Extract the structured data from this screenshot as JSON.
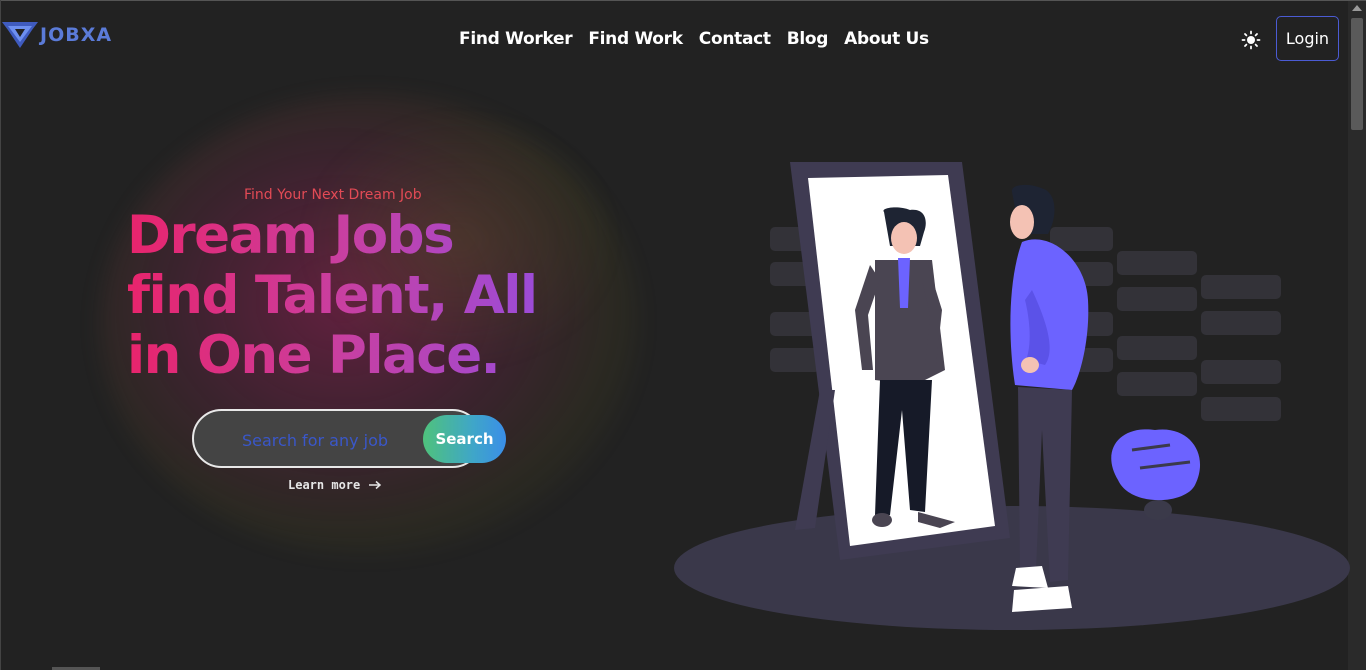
{
  "app": {
    "brand": "JOBXA",
    "brand_color": "#5b7bd8"
  },
  "nav": {
    "items": [
      {
        "label": "Find Worker"
      },
      {
        "label": "Find Work"
      },
      {
        "label": "Contact"
      },
      {
        "label": "Blog"
      },
      {
        "label": "About Us"
      }
    ],
    "theme_icon": "sun-icon",
    "login_label": "Login"
  },
  "hero": {
    "eyebrow": "Find Your Next Dream Job",
    "headline_lines": [
      "Dream Jobs",
      "find Talent, All",
      "in One Place."
    ],
    "search_placeholder": "Search for any job",
    "search_button": "Search",
    "learn_more": "Learn more",
    "learn_more_icon": "arrow-right-icon"
  },
  "colors": {
    "background": "#222222",
    "accent_pink": "#e8246c",
    "accent_purple": "#8e4fe8",
    "eyebrow": "#e24a55",
    "search_gradient_start": "#4fc27c",
    "search_gradient_end": "#3a8ee8",
    "illustration_purple": "#6c63ff"
  }
}
